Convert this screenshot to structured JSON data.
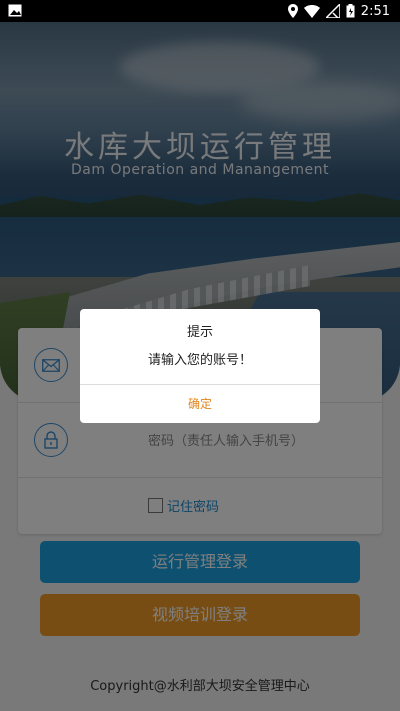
{
  "status_bar": {
    "time": "2:51"
  },
  "header": {
    "title": "水库大坝运行管理",
    "subtitle": "Dam Operation and Manangement"
  },
  "login": {
    "username_placeholder": "",
    "password_placeholder": "密码（责任人输入手机号）",
    "remember_label": "记住密码"
  },
  "buttons": {
    "ops_login": "运行管理登录",
    "video_login": "视频培训登录"
  },
  "footer": {
    "copyright": "Copyright@水利部大坝安全管理中心"
  },
  "dialog": {
    "title": "提示",
    "message": "请输入您的账号！",
    "confirm": "确定"
  },
  "colors": {
    "accent_blue": "#1ca1e0",
    "accent_orange": "#ef9a26",
    "icon_blue": "#3a8ccc",
    "link_blue": "#1a8ad0"
  }
}
